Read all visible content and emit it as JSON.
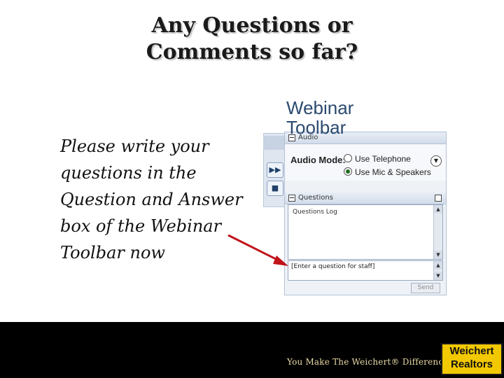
{
  "slide": {
    "title_line1": "Any Questions or",
    "title_line2": "Comments so far?",
    "body_lines": [
      "Please write your",
      "questions in the",
      "Question and Answer",
      "box of the Webinar",
      "Toolbar now"
    ],
    "toolbar_label_line1": "Webinar",
    "toolbar_label_line2": "Toolbar"
  },
  "toolbar": {
    "side_buttons": [
      "fast-forward-icon",
      "stop-icon"
    ],
    "audio": {
      "section_label": "Audio",
      "mode_label": "Audio Mode:",
      "options": [
        "Use Telephone",
        "Use Mic & Speakers"
      ],
      "selected": "Use Mic & Speakers"
    },
    "questions": {
      "section_label": "Questions",
      "log_label": "Questions Log",
      "input_placeholder": "[Enter a question for staff]",
      "send_label": "Send"
    }
  },
  "arrow_color": "#c0141a",
  "footer": {
    "tagline": "You Make The Weichert® Difference.",
    "logo_line1": "Weichert",
    "logo_line2": "Realtors",
    "logo_color": "#f2c800"
  }
}
